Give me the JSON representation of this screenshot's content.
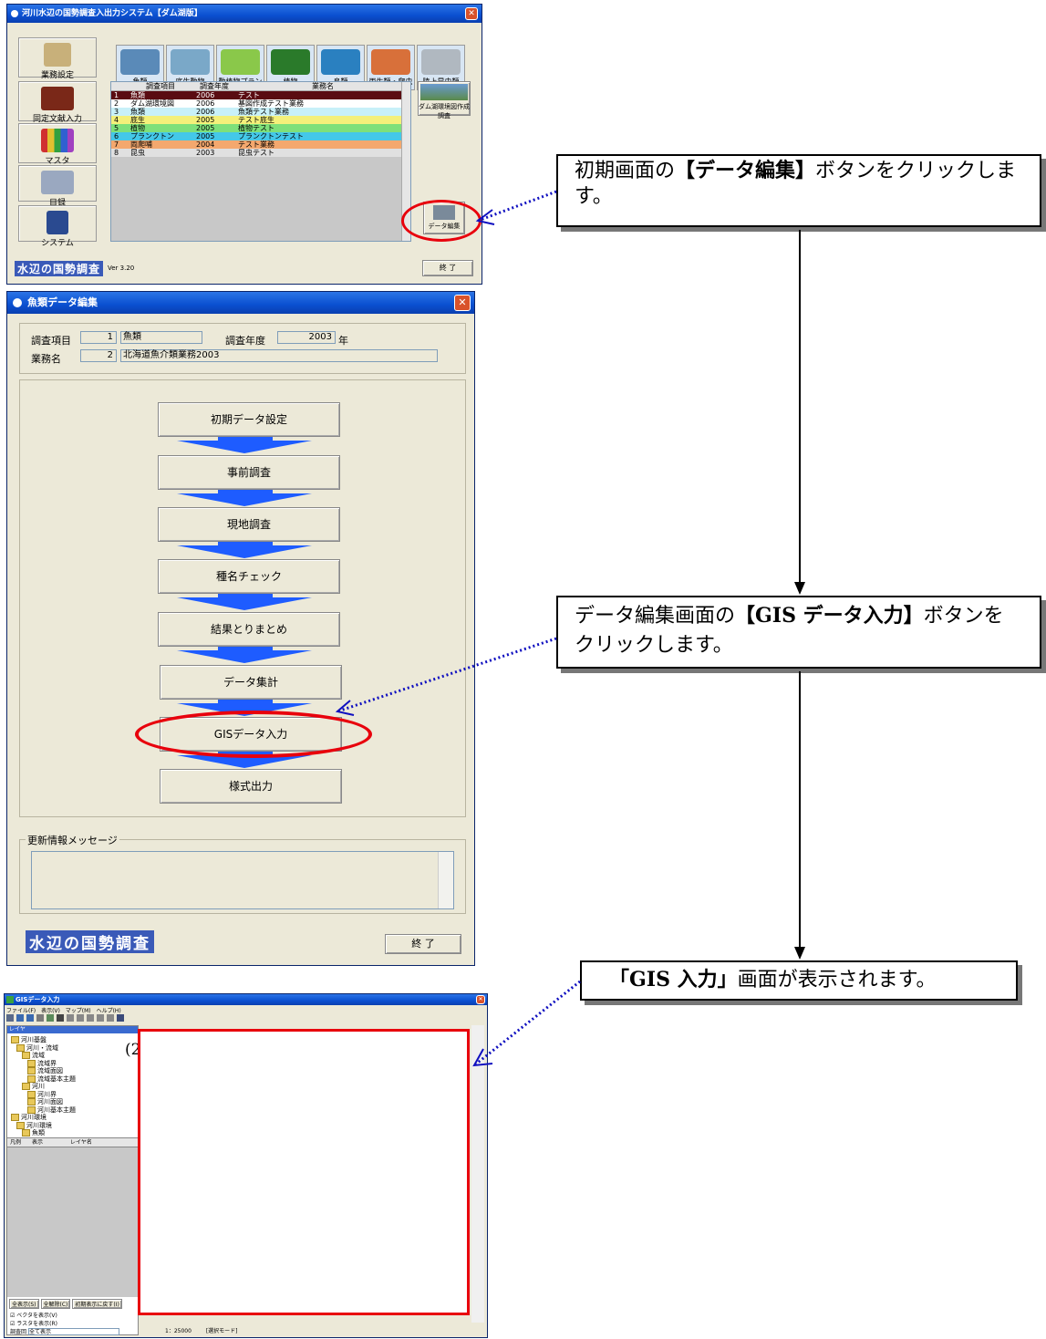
{
  "window1": {
    "title": "河川水辺の国勢調査入出力システム【ダム湖版】",
    "close": "✕",
    "nav_buttons": [
      "業務設定",
      "同定文献入力",
      "マスタ",
      "目録",
      "システム"
    ],
    "categories": [
      "魚類",
      "底生動物",
      "動植物プランクトン",
      "植物",
      "鳥類",
      "両生類・爬虫類・哺乳類",
      "陸上昆虫類"
    ],
    "grid_headers": [
      "",
      "調査項目",
      "調査年度",
      "業務名"
    ],
    "grid_rows": [
      {
        "no": "1",
        "item": "魚類",
        "year": "2006",
        "name": "テスト",
        "color": "#5a0c12",
        "text": "#ffffff"
      },
      {
        "no": "2",
        "item": "ダム湖環境図",
        "year": "2006",
        "name": "基図作成テスト業務",
        "color": "#ffffff",
        "text": "#000000"
      },
      {
        "no": "3",
        "item": "魚類",
        "year": "2006",
        "name": "魚類テスト業務",
        "color": "#c8f0f8",
        "text": "#000000"
      },
      {
        "no": "4",
        "item": "底生",
        "year": "2005",
        "name": "テスト底生",
        "color": "#f4f07a",
        "text": "#000000"
      },
      {
        "no": "5",
        "item": "植物",
        "year": "2005",
        "name": "植物テスト",
        "color": "#7ee07a",
        "text": "#000000"
      },
      {
        "no": "6",
        "item": "プランクトン",
        "year": "2005",
        "name": "プランクトンテスト",
        "color": "#44c8e8",
        "text": "#000000"
      },
      {
        "no": "7",
        "item": "両爬哺",
        "year": "2004",
        "name": "テスト業務",
        "color": "#f4a86e",
        "text": "#000000"
      },
      {
        "no": "8",
        "item": "昆虫",
        "year": "2003",
        "name": "昆虫テスト",
        "color": "#e0e0e0",
        "text": "#000000"
      }
    ],
    "right_button_label": "ダム湖環境図作成調査",
    "data_edit_label": "データ編集",
    "logo": "水辺の国勢調査",
    "version": "Ver 3.20",
    "exit": "終 了"
  },
  "window2": {
    "title": "魚類データ編集",
    "close": "✕",
    "field_item_label": "調査項目",
    "field_item_no": "1",
    "field_item_value": "魚類",
    "field_year_label": "調査年度",
    "field_year_value": "2003",
    "field_year_unit": "年",
    "field_name_label": "業務名",
    "field_name_no": "2",
    "field_name_value": "北海道魚介類業務2003",
    "flow_buttons": [
      "初期データ設定",
      "事前調査",
      "現地調査",
      "種名チェック",
      "結果とりまとめ",
      "データ集計",
      "GISデータ入力",
      "様式出力"
    ],
    "message_label": "更新情報メッセージ",
    "logo": "水辺の国勢調査",
    "exit": "終 了"
  },
  "window3": {
    "title": "GISデータ入力",
    "menu": [
      "ファイル(F)",
      "表示(V)",
      "マップ(M)",
      "ヘルプ(H)"
    ],
    "panel_title": "レイヤ",
    "tree": [
      "河川基盤",
      "河川・流域",
      "流域",
      "流域界",
      "流域面図",
      "流域基本主題",
      "河川",
      "河川界",
      "河川面図",
      "河川基本主題",
      "河川環境",
      "河川環境",
      "魚類"
    ],
    "list_headers": [
      "凡例",
      "表示",
      "レイヤ名"
    ],
    "bottom_buttons": [
      "全表示(S)",
      "全解除(C)",
      "初期表示に戻す(I)"
    ],
    "checkboxes": [
      "ベクタを表示(V)",
      "ラスタを表示(R)"
    ],
    "filter_label": "調査回",
    "filter_value": "全て表示",
    "status": [
      "1：25000",
      "[選択モード]"
    ],
    "marker": "(2)"
  },
  "callouts": {
    "c1_pre": "初期画面の",
    "c1_bold": "【データ編集】",
    "c1_post": "ボタンをクリックします。",
    "c2_pre": "データ編集画面の",
    "c2_bold": "【GIS データ入力】",
    "c2_post": "ボタンをクリックします。",
    "c3_bold": "「GIS 入力」",
    "c3_post": "画面が表示されます。"
  },
  "colors": {
    "highlight": "#e8000c",
    "arrow": "#1e5cff",
    "dotted": "#1010c0"
  }
}
